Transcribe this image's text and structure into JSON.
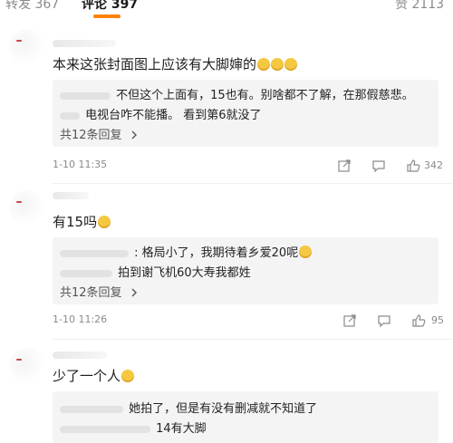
{
  "tabs": {
    "repost": "转发 367",
    "comments": "评论 397",
    "likes": "赞 2113"
  },
  "comments": [
    {
      "text": "本来这张封面图上应该有大脚婶的",
      "replies": [
        "不但这个上面有，15也有。别啥都不了解，在那假慈悲。",
        "电视台咋不能播。 看到第6就没了"
      ],
      "more_replies": "共12条回复",
      "time": "1-10 11:35",
      "likes": "342"
    },
    {
      "text": "有15吗",
      "replies": [
        ": 格局小了，我期待着乡爱20呢",
        "拍到谢飞机60大寿我都姓"
      ],
      "more_replies": "共12条回复",
      "time": "1-10 11:26",
      "likes": "95"
    },
    {
      "text": "少了一个人",
      "replies": [
        "她拍了，但是有没有删减就不知道了",
        "14有大脚"
      ]
    }
  ],
  "icons": {
    "share": "share-icon",
    "comment": "comment-icon",
    "like": "thumbs-up-icon",
    "chevron": "chevron-right-icon"
  },
  "colors": {
    "accent": "#ff8200",
    "reply_bg": "#f4f4f4",
    "meta_text": "#8a8a8a"
  }
}
